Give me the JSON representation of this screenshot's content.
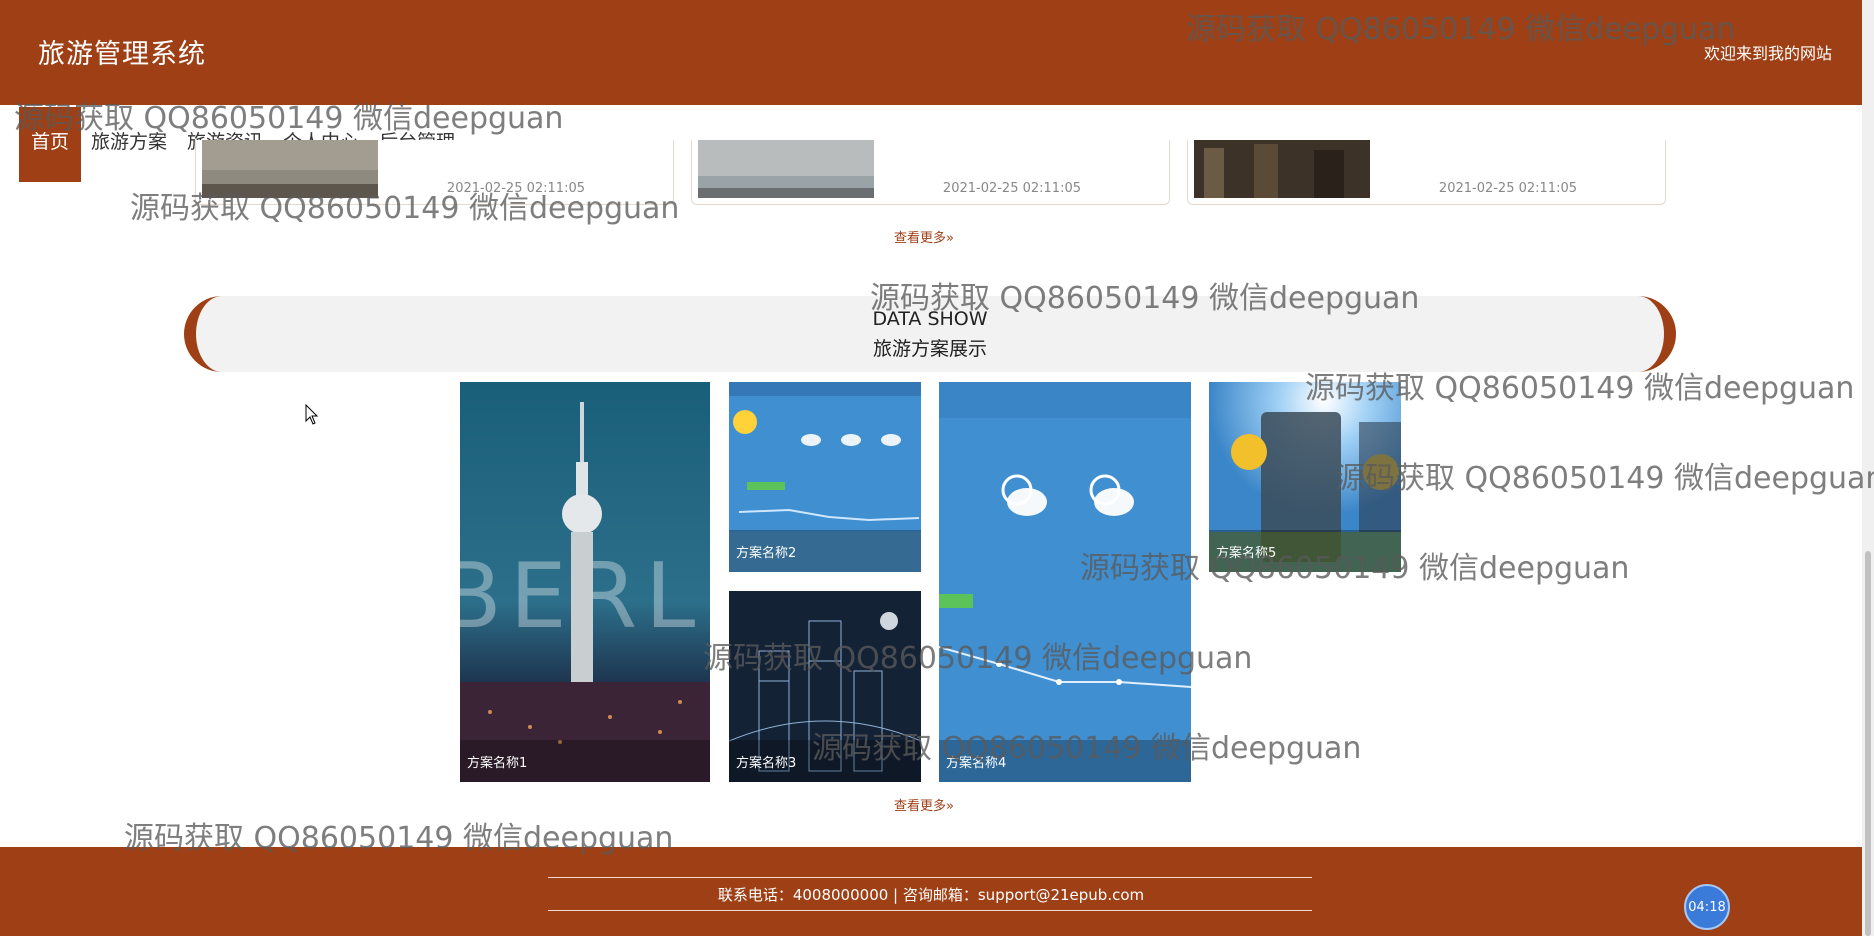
{
  "header": {
    "site_title": "旅游管理系统",
    "welcome_text": "欢迎来到我的网站"
  },
  "nav": {
    "items": [
      {
        "label": "首页",
        "active": true
      },
      {
        "label": "旅游方案",
        "active": false
      },
      {
        "label": "旅游资讯",
        "active": false
      },
      {
        "label": "个人中心",
        "active": false
      },
      {
        "label": "后台管理",
        "active": false
      }
    ]
  },
  "news": {
    "dates": [
      "2021-02-25 02:11:05",
      "2021-02-25 02:11:05",
      "2021-02-25 02:11:05"
    ],
    "more_label": "查看更多»"
  },
  "section": {
    "title_en": "DATA SHOW",
    "title_cn": "旅游方案展示"
  },
  "plans": {
    "items": [
      {
        "caption": "方案名称1",
        "image": "berlin-tv-tower"
      },
      {
        "caption": "方案名称2",
        "image": "weather-forecast"
      },
      {
        "caption": "方案名称3",
        "image": "city-line-drawing"
      },
      {
        "caption": "方案名称4",
        "image": "weather-forecast-large"
      },
      {
        "caption": "方案名称5",
        "image": "weather-app-sun"
      }
    ],
    "more_label": "查看更多»"
  },
  "footer": {
    "contact_text": "联系电话：4008000000 | 咨询邮箱：support@21epub.com"
  },
  "clock": {
    "time": "04:18"
  },
  "watermark": {
    "text": "源码获取 QQ86050149 微信deepguan"
  },
  "colors": {
    "brand": "#9e3f15",
    "accent_blue": "#3a7ad9"
  }
}
